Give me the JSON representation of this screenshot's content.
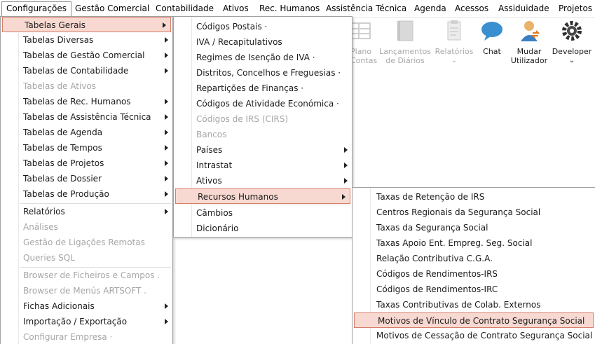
{
  "menubar": [
    "Configurações",
    "Gestão Comercial",
    "Contabilidade",
    "Ativos",
    "Rec. Humanos",
    "Assistência Técnica",
    "Agenda",
    "Acessos",
    "Assiduidade",
    "Projetos"
  ],
  "ribbon": {
    "plano_contas": [
      "Plano",
      "Contas"
    ],
    "lancamentos": [
      "Lançamentos",
      "de Diários"
    ],
    "relatorios": "Relatórios",
    "chat": "Chat",
    "mudar_utilizador": [
      "Mudar",
      "Utilizador"
    ],
    "developer": "Developer",
    "chevron": "⌄"
  },
  "menu1": [
    "Tabelas Gerais",
    "Tabelas Diversas",
    "Tabelas de Gestão Comercial",
    "Tabelas de Contabilidade",
    "Tabelas de Ativos",
    "Tabelas de Rec. Humanos",
    "Tabelas de Assistência Técnica",
    "Tabelas de Agenda",
    "Tabelas de Tempos",
    "Tabelas de Projetos",
    "Tabelas de Dossier",
    "Tabelas de Produção",
    "Relatórios",
    "Análises",
    "Gestão de Ligações Remotas",
    "Queries SQL",
    "Browser de Ficheiros e Campos .",
    "Browser de Menús ARTSOFT .",
    "Fichas Adicionais",
    "Importação / Exportação",
    "Configurar Empresa ·"
  ],
  "menu2": [
    "Códigos Postais ·",
    "IVA / Recapitulativos",
    "Regimes de Isenção de IVA ·",
    "Distritos, Concelhos e Freguesias ·",
    "Repartições de Finanças ·",
    "Códigos de Atividade Económica ·",
    "Códigos de IRS (CIRS)",
    "Bancos",
    "Países",
    "Intrastat",
    "Ativos",
    "Recursos Humanos",
    "Câmbios",
    "Dicionário"
  ],
  "menu3": [
    "Taxas de Retenção de IRS",
    "Centros Regionais da Segurança Social",
    "Taxas da Segurança Social",
    "Taxas Apoio Ent. Empreg. Seg. Social",
    "Relação Contributiva C.G.A.",
    "Códigos de Rendimentos-IRS",
    "Códigos de Rendimentos-IRC",
    "Taxas Contributivas de Colab. Externos",
    "Motivos de Vínculo de Contrato Segurança Social",
    "Motivos de Cessação de Contrato Segurança Social"
  ],
  "colors": {
    "highlight_bg": "#f8d9d1",
    "highlight_border": "#d77e6a",
    "disabled_text": "#a6a6a6"
  }
}
